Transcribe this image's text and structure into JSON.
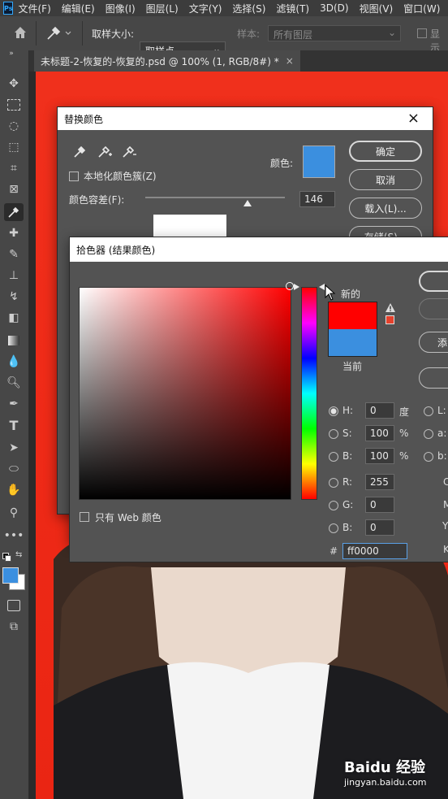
{
  "menubar": {
    "logo": "Ps",
    "items": [
      "文件(F)",
      "编辑(E)",
      "图像(I)",
      "图层(L)",
      "文字(Y)",
      "选择(S)",
      "滤镜(T)",
      "3D(D)",
      "视图(V)",
      "窗口(W)",
      "帮"
    ]
  },
  "optionsbar": {
    "sample_size_label": "取样大小:",
    "sample_size_value": "取样点",
    "sample_label": "样本:",
    "sample_value": "所有图层",
    "show_label": "显示"
  },
  "tabs": {
    "doc_title": "未标题-2-恢复的-恢复的.psd @ 100% (1, RGB/8#) *",
    "close": "×"
  },
  "replace_color": {
    "title": "替换颜色",
    "close": "×",
    "localized_label": "本地化颜色簇(Z)",
    "color_label": "颜色:",
    "fuzziness_label": "颜色容差(F):",
    "fuzziness_value": "146",
    "fuzziness_fraction": 0.73,
    "swatch_color": "#3b8fdf",
    "ok": "确定",
    "cancel": "取消",
    "load": "载入(L)...",
    "save": "存储(S)..."
  },
  "picker": {
    "title": "拾色器 (结果颜色)",
    "new_label": "新的",
    "current_label": "当前",
    "new_color": "#ff0000",
    "current_color": "#3b8fdf",
    "web_only_label": "只有 Web 颜色",
    "h_label": "H:",
    "h_value": "0",
    "h_unit": "度",
    "s_label": "S:",
    "s_value": "100",
    "s_unit": "%",
    "b_label": "B:",
    "b_value": "100",
    "b_unit": "%",
    "r_label": "R:",
    "r_value": "255",
    "g_label": "G:",
    "g_value": "0",
    "blue_label": "B:",
    "blue_value": "0",
    "l_label": "L:",
    "a_label": "a:",
    "lab_b_label": "b:",
    "c_label": "C",
    "m_label": "M",
    "y_label": "Y",
    "k_label": "K",
    "hex_label": "#",
    "hex_value": "ff0000",
    "add_label": "添"
  },
  "watermark": {
    "brand": "Baidu 经验",
    "url": "jingyan.baidu.com"
  }
}
